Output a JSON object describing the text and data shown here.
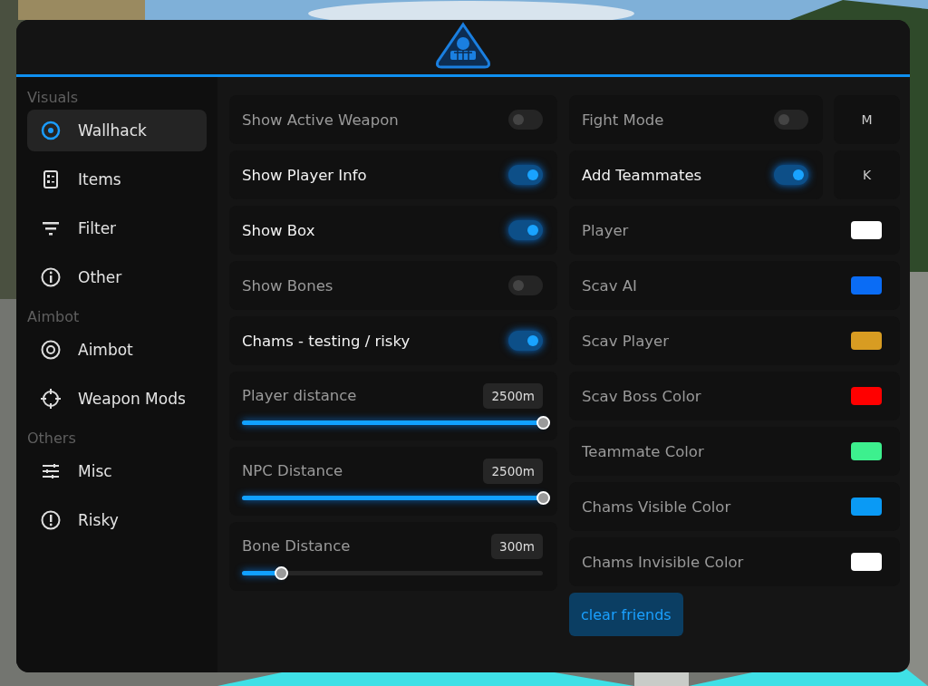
{
  "sidebar": {
    "sections": [
      {
        "title": "Visuals",
        "items": [
          {
            "label": "Wallhack",
            "selected": true
          },
          {
            "label": "Items",
            "selected": false
          },
          {
            "label": "Filter",
            "selected": false
          },
          {
            "label": "Other",
            "selected": false
          }
        ]
      },
      {
        "title": "Aimbot",
        "items": [
          {
            "label": "Aimbot",
            "selected": false
          },
          {
            "label": "Weapon Mods",
            "selected": false
          }
        ]
      },
      {
        "title": "Others",
        "items": [
          {
            "label": "Misc",
            "selected": false
          },
          {
            "label": "Risky",
            "selected": false
          }
        ]
      }
    ]
  },
  "left_settings": [
    {
      "kind": "toggle",
      "label": "Show Active Weapon",
      "on": false
    },
    {
      "kind": "toggle",
      "label": "Show Player Info",
      "on": true
    },
    {
      "kind": "toggle",
      "label": "Show Box",
      "on": true
    },
    {
      "kind": "toggle",
      "label": "Show Bones",
      "on": false
    },
    {
      "kind": "toggle",
      "label": "Chams - testing / risky",
      "on": true
    },
    {
      "kind": "slider",
      "label": "Player distance",
      "reading": "2500m",
      "level": 1
    },
    {
      "kind": "slider",
      "label": "NPC Distance",
      "reading": "2500m",
      "level": 1
    },
    {
      "kind": "slider",
      "label": "Bone Distance",
      "reading": "300m",
      "level": 0.13
    }
  ],
  "right_settings": [
    {
      "kind": "toggle",
      "label": "Fight Mode",
      "on": false,
      "key": "M"
    },
    {
      "kind": "toggle",
      "label": "Add Teammates",
      "on": true,
      "key": "K"
    },
    {
      "kind": "color",
      "label": "Player",
      "color": "#ffffff"
    },
    {
      "kind": "color",
      "label": "Scav AI",
      "color": "#0a6cf5"
    },
    {
      "kind": "color",
      "label": "Scav Player",
      "color": "#d89c22"
    },
    {
      "kind": "color",
      "label": "Scav Boss Color",
      "color": "#ff0000"
    },
    {
      "kind": "color",
      "label": "Teammate Color",
      "color": "#3df08e"
    },
    {
      "kind": "color",
      "label": "Chams Visible Color",
      "color": "#0a9af5"
    },
    {
      "kind": "color",
      "label": "Chams Invisible Color",
      "color": "#ffffff"
    }
  ],
  "clear_button": "clear friends"
}
